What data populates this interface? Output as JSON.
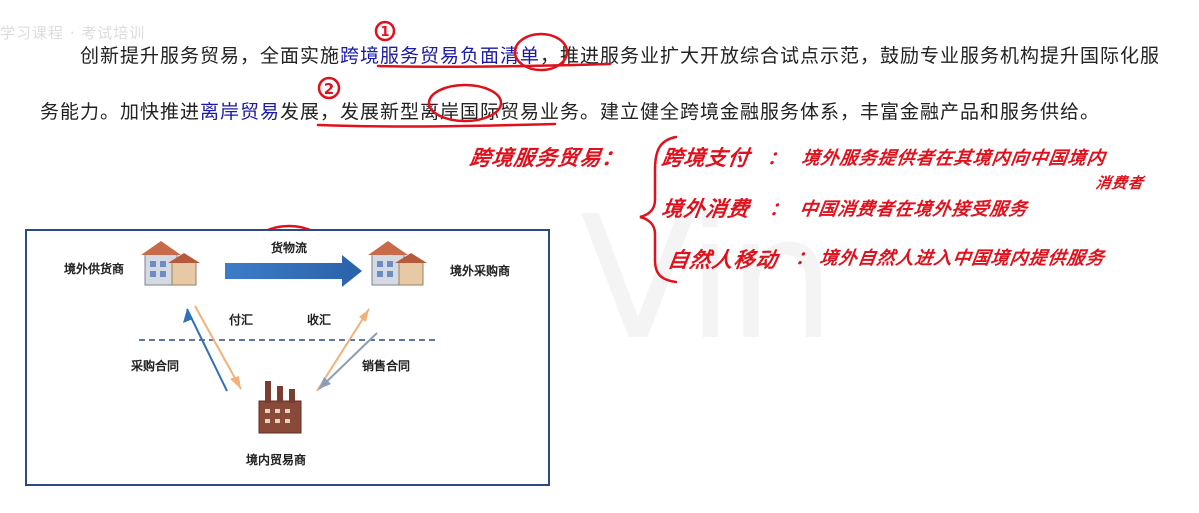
{
  "watermark": "学习课程 · 考试培训",
  "background_letters": "Vin",
  "paragraph": {
    "seg1": "创新提升服务贸易，全面实施",
    "seg2_link": "跨境服务贸易负面清单",
    "seg3": "，推进服务业扩大开放综合试点示范，鼓励专业服务机构提升国际化服务能力。加快推进",
    "seg4_link": "离岸贸易",
    "seg5": "发展，发展新型离岸国际贸易业务。建立健全跨境金融服务体系，丰富金融产品和服务供给。"
  },
  "annotation_numbers": [
    "1",
    "2"
  ],
  "diagram": {
    "left_party": "境外供货商",
    "right_party": "境外采购商",
    "bottom_party": "境内贸易商",
    "top_flow": "货物流",
    "pay_label": "付汇",
    "receive_label": "收汇",
    "left_contract": "采购合同",
    "right_contract": "销售合同"
  },
  "handwritten": {
    "title": "跨境服务贸易：",
    "items": [
      {
        "term": "跨境支付",
        "sep": "：",
        "definition": "境外服务提供者在其境内向中国境内"
      },
      {
        "term": "境外消费",
        "sep": "：",
        "definition": "中国消费者在境外接受服务",
        "extra": "消费者"
      },
      {
        "term": "自然人移动",
        "sep": "：",
        "definition": "境外自然人进入中国境内提供服务"
      }
    ]
  },
  "colors": {
    "text": "#222222",
    "link": "#1a1aa6",
    "annotation_red": "#e0111c",
    "diagram_border": "#2b4a84",
    "arrow_blue": "#2e73b8",
    "arrow_orange": "#f0b27a",
    "arrow_gray": "#8c9db5"
  }
}
